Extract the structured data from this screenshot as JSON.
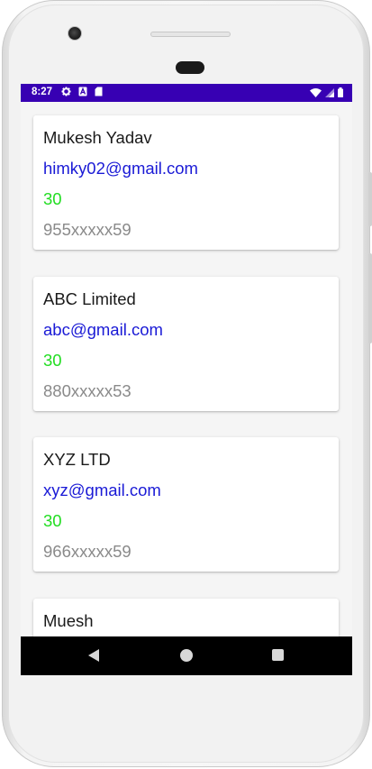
{
  "status_bar": {
    "time": "8:27",
    "left_icons": [
      "gear-icon",
      "a-box-icon",
      "sd-card-icon"
    ],
    "right_icons": [
      "wifi-icon",
      "signal-icon",
      "battery-icon"
    ],
    "background_color": "#3700b3"
  },
  "contacts": [
    {
      "name": "Mukesh Yadav",
      "email": "himky02@gmail.com",
      "age": "30",
      "phone": "955xxxxx59"
    },
    {
      "name": "ABC Limited",
      "email": "abc@gmail.com",
      "age": "30",
      "phone": "880xxxxx53"
    },
    {
      "name": "XYZ LTD",
      "email": "xyz@gmail.com",
      "age": "30",
      "phone": "966xxxxx59"
    },
    {
      "name": "Muesh",
      "email": "",
      "age": "",
      "phone": ""
    }
  ],
  "colors": {
    "name": "#1a1a1a",
    "email": "#1a1ad6",
    "age": "#22dd22",
    "phone": "#8a8a8a"
  },
  "nav_bar": {
    "buttons": [
      "back-icon",
      "home-icon",
      "recent-apps-icon"
    ]
  }
}
